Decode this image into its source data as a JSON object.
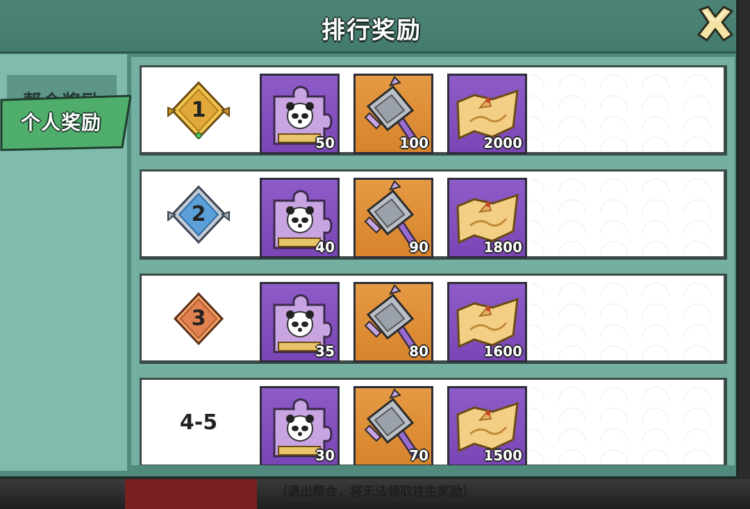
{
  "window": {
    "title": "排行奖励"
  },
  "tabs": [
    {
      "label": "帮会奖励",
      "active": false
    },
    {
      "label": "个人奖励",
      "active": true
    }
  ],
  "rows": [
    {
      "rank": "1",
      "badge": "gold-diamond-1",
      "rewards": [
        {
          "item": "panda-puzzle-piece-icon",
          "qty": "50"
        },
        {
          "item": "forging-hammer-icon",
          "qty": "100"
        },
        {
          "item": "map-scroll-icon",
          "qty": "2000"
        }
      ]
    },
    {
      "rank": "2",
      "badge": "blue-diamond-2",
      "rewards": [
        {
          "item": "panda-puzzle-piece-icon",
          "qty": "40"
        },
        {
          "item": "forging-hammer-icon",
          "qty": "90"
        },
        {
          "item": "map-scroll-icon",
          "qty": "1800"
        }
      ]
    },
    {
      "rank": "3",
      "badge": "orange-diamond-3",
      "rewards": [
        {
          "item": "panda-puzzle-piece-icon",
          "qty": "35"
        },
        {
          "item": "forging-hammer-icon",
          "qty": "80"
        },
        {
          "item": "map-scroll-icon",
          "qty": "1600"
        }
      ]
    },
    {
      "rank": "4-5",
      "badge": "",
      "rewards": [
        {
          "item": "panda-puzzle-piece-icon",
          "qty": "30"
        },
        {
          "item": "forging-hammer-icon",
          "qty": "70"
        },
        {
          "item": "map-scroll-icon",
          "qty": "1500"
        }
      ]
    }
  ],
  "footer_note": "（退出帮会，将无法领取往生奖励）",
  "colors": {
    "panel": "#4f8a7c",
    "tab_active": "#4fae6b",
    "item_purple": "#8d5cc7",
    "item_orange": "#e59a43",
    "gold": "#d9a93a",
    "blue": "#5b9fd8",
    "bronze": "#e1814f"
  }
}
